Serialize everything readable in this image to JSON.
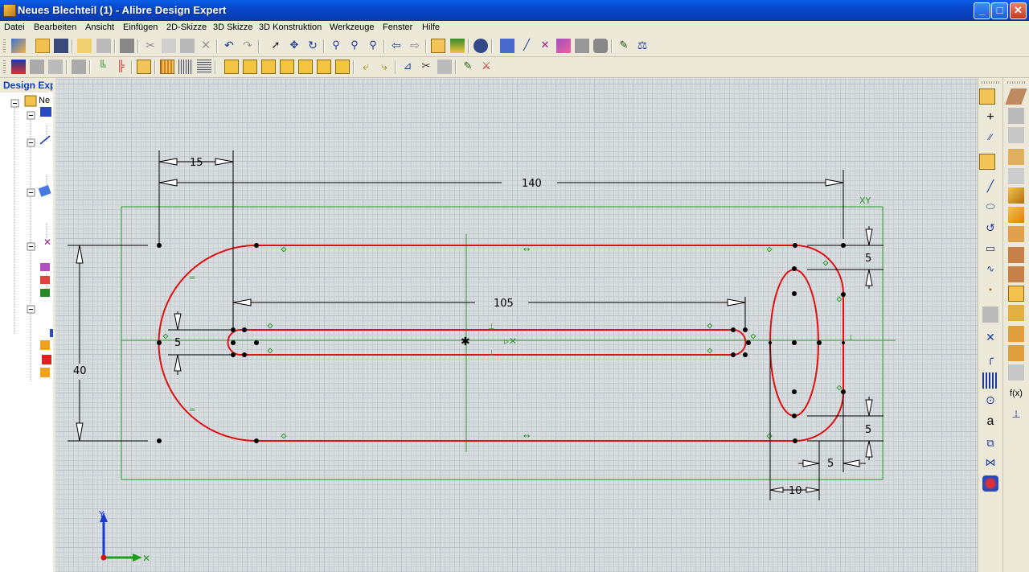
{
  "window": {
    "title": "Neues Blechteil (1) - Alibre Design Expert",
    "buttons": {
      "minimize": "_",
      "maximize": "□",
      "close": "✕"
    }
  },
  "menu": [
    "Datei",
    "Bearbeiten",
    "Ansicht",
    "Einfügen",
    "2D-Skizze",
    "3D Skizze",
    "3D Konstruktion",
    "Werkzeuge",
    "Fenster",
    "Hilfe"
  ],
  "left_panel": {
    "header": "Design Expl",
    "root_item": "Ne"
  },
  "sketch": {
    "dimensions": {
      "top_offset": "15",
      "overall_length": "140",
      "slot_length": "105",
      "slot_width": "5",
      "height": "40",
      "top_right_gap": "5",
      "bottom_right_gap": "5",
      "right_offset": "5",
      "ellipse_width": "10"
    },
    "plane_label": "XY"
  },
  "colors": {
    "profile": "#e01010",
    "construction": "#2a9a2a",
    "dimension": "#000000",
    "accent": "#f2c45a"
  },
  "right_palette": {
    "function_label": "f(x)",
    "text_label": "a"
  }
}
